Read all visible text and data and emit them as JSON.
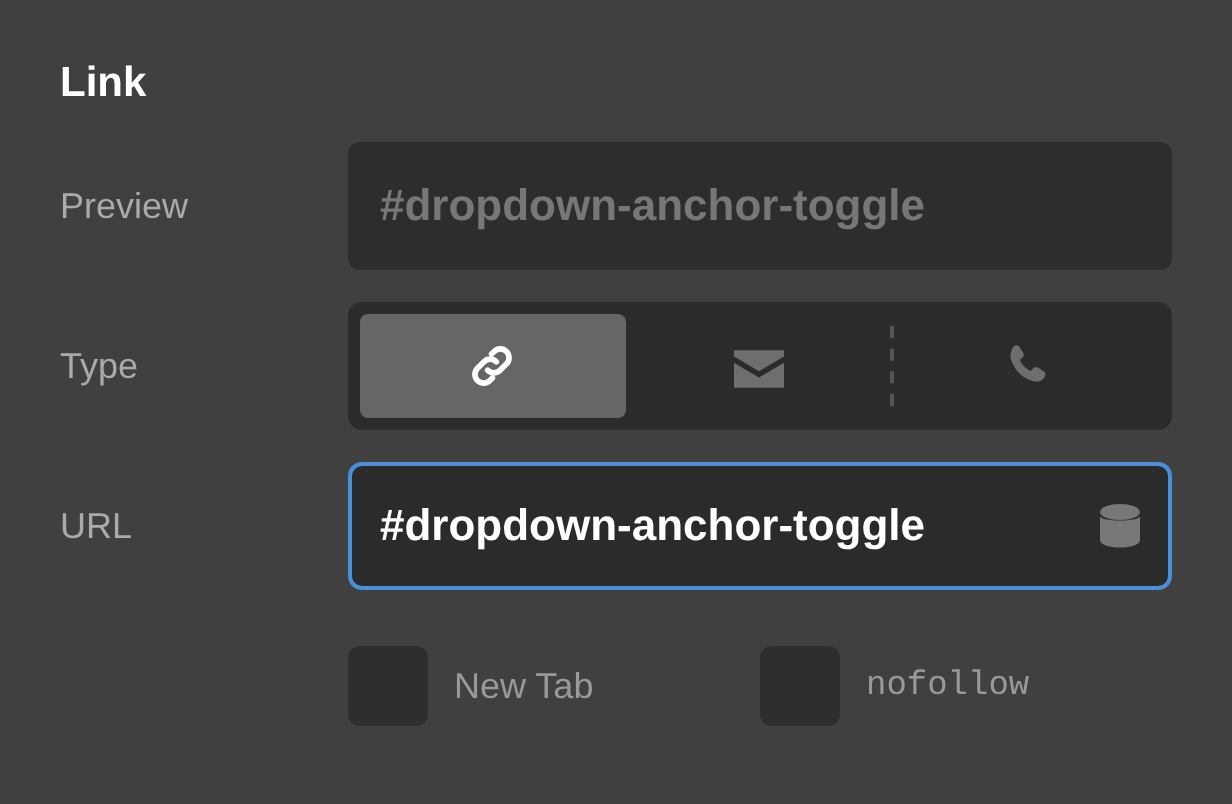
{
  "title": "Link",
  "preview": {
    "label": "Preview",
    "value": "#dropdown-anchor-toggle"
  },
  "type": {
    "label": "Type",
    "options": [
      {
        "kind": "link",
        "selected": true
      },
      {
        "kind": "mail",
        "selected": false
      },
      {
        "kind": "phone",
        "selected": false
      }
    ]
  },
  "url": {
    "label": "URL",
    "value": "#dropdown-anchor-toggle",
    "focused": true
  },
  "checkboxes": [
    {
      "label": "New Tab",
      "checked": false,
      "kind": "sans"
    },
    {
      "label": "nofollow",
      "checked": false,
      "kind": "mono"
    }
  ]
}
